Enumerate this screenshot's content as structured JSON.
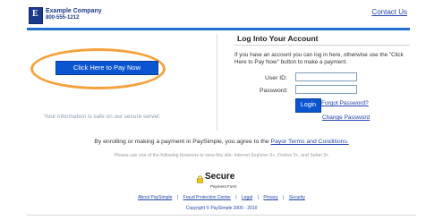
{
  "header": {
    "logo_letter": "E",
    "company_name": "Example Company",
    "company_phone": "800-555-1212",
    "contact_link": "Contact Us",
    "bar_color": "#1f6fcf"
  },
  "left_panel": {
    "pay_now_label": "Click Here to Pay Now",
    "secure_note": "Your information is safe on our secure server.",
    "highlight_color": "#f5a13a"
  },
  "login": {
    "title": "Log Into Your Account",
    "description": "If you have an account you can log in here, otherwise use the \"Click Here to Pay Now\" button to make a payment.",
    "userid_label": "User ID:",
    "userid_value": "",
    "password_label": "Password:",
    "password_value": "",
    "login_button": "Login",
    "forgot_password": "Forgot Password?",
    "change_password": "Change Password"
  },
  "terms": {
    "prefix": "By enrolling or making a payment in PaySimple, you agree to the ",
    "link": "Payor Terms and Conditions.",
    "browsers_note": "Please use one of the following browsers to view this site: Internet Explorer 6+, Firefox 3+, and Safari 3+"
  },
  "secure_badge": {
    "title": "Secure",
    "subtitle": "Payment Form",
    "icon": "lock-icon"
  },
  "footer": {
    "links": [
      "About PaySimple",
      "Fraud Protection Center",
      "Legal",
      "Privacy",
      "Security"
    ],
    "separator": "|",
    "copyright": "Copyright © PaySimple 2005 - 2010"
  }
}
